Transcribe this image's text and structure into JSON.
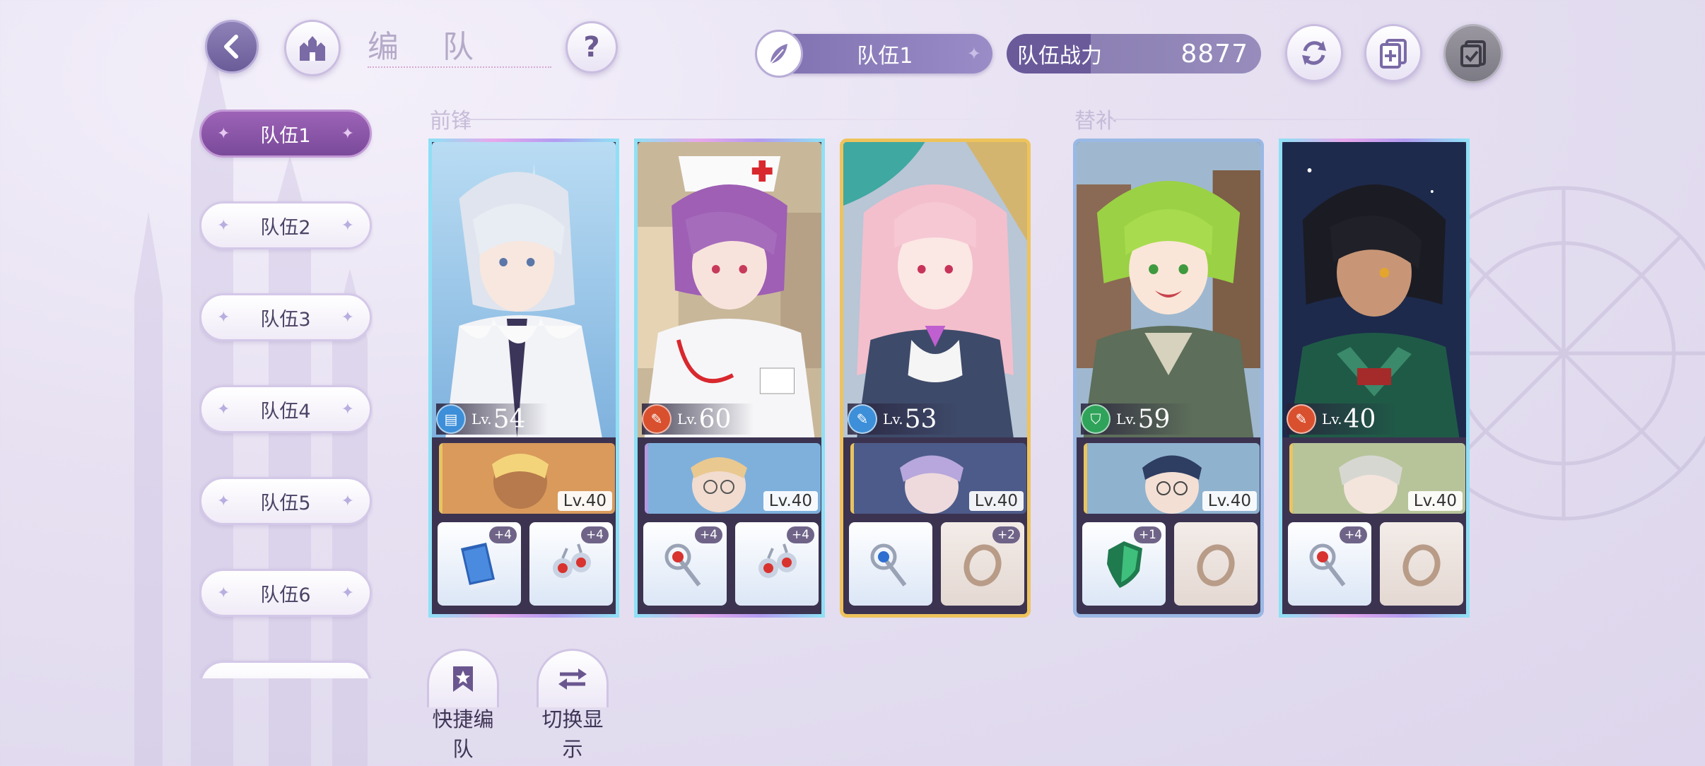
{
  "header": {
    "title": "编 队",
    "team_selector_label": "队伍1",
    "power_label": "队伍战力",
    "power_value": "8877"
  },
  "sidebar": {
    "teams": [
      {
        "label": "队伍1",
        "active": true
      },
      {
        "label": "队伍2",
        "active": false
      },
      {
        "label": "队伍3",
        "active": false
      },
      {
        "label": "队伍4",
        "active": false
      },
      {
        "label": "队伍5",
        "active": false
      },
      {
        "label": "队伍6",
        "active": false
      },
      {
        "label": "",
        "active": false
      }
    ]
  },
  "sections": {
    "front": "前锋",
    "bench": "替补"
  },
  "cards": [
    {
      "lv_prefix": "Lv.",
      "level": "54",
      "role_icon": "book-role-icon",
      "role_color": "#3c8fd8",
      "support_level": "Lv.40",
      "equip": [
        {
          "icon": "book-icon",
          "plus": "+4"
        },
        {
          "icon": "earrings-icon",
          "plus": "+4"
        }
      ]
    },
    {
      "lv_prefix": "Lv.",
      "level": "60",
      "role_icon": "wand-role-icon",
      "role_color": "#d9502e",
      "support_level": "Lv.40",
      "equip": [
        {
          "icon": "wand-icon",
          "plus": "+4"
        },
        {
          "icon": "earrings-icon",
          "plus": "+4"
        }
      ]
    },
    {
      "lv_prefix": "Lv.",
      "level": "53",
      "role_icon": "wand-role-icon",
      "role_color": "#3c8fd8",
      "support_level": "Lv.40",
      "equip": [
        {
          "icon": "wand-icon",
          "plus": ""
        },
        {
          "icon": "ring-icon",
          "plus": "+2"
        }
      ]
    },
    {
      "lv_prefix": "Lv.",
      "level": "59",
      "role_icon": "shield-role-icon",
      "role_color": "#2fa35a",
      "support_level": "Lv.40",
      "equip": [
        {
          "icon": "shield-icon",
          "plus": "+1"
        },
        {
          "icon": "ring-icon",
          "plus": ""
        }
      ]
    },
    {
      "lv_prefix": "Lv.",
      "level": "40",
      "role_icon": "wand-role-icon",
      "role_color": "#d9502e",
      "support_level": "Lv.40",
      "equip": [
        {
          "icon": "wand-icon",
          "plus": "+4"
        },
        {
          "icon": "ring-icon",
          "plus": ""
        }
      ]
    }
  ],
  "bottom": {
    "quick_label": "快捷编队",
    "switch_label": "切换显示"
  },
  "colors": {
    "accent_purple": "#7a4a9a",
    "power_bar": "#6a5a9a"
  }
}
